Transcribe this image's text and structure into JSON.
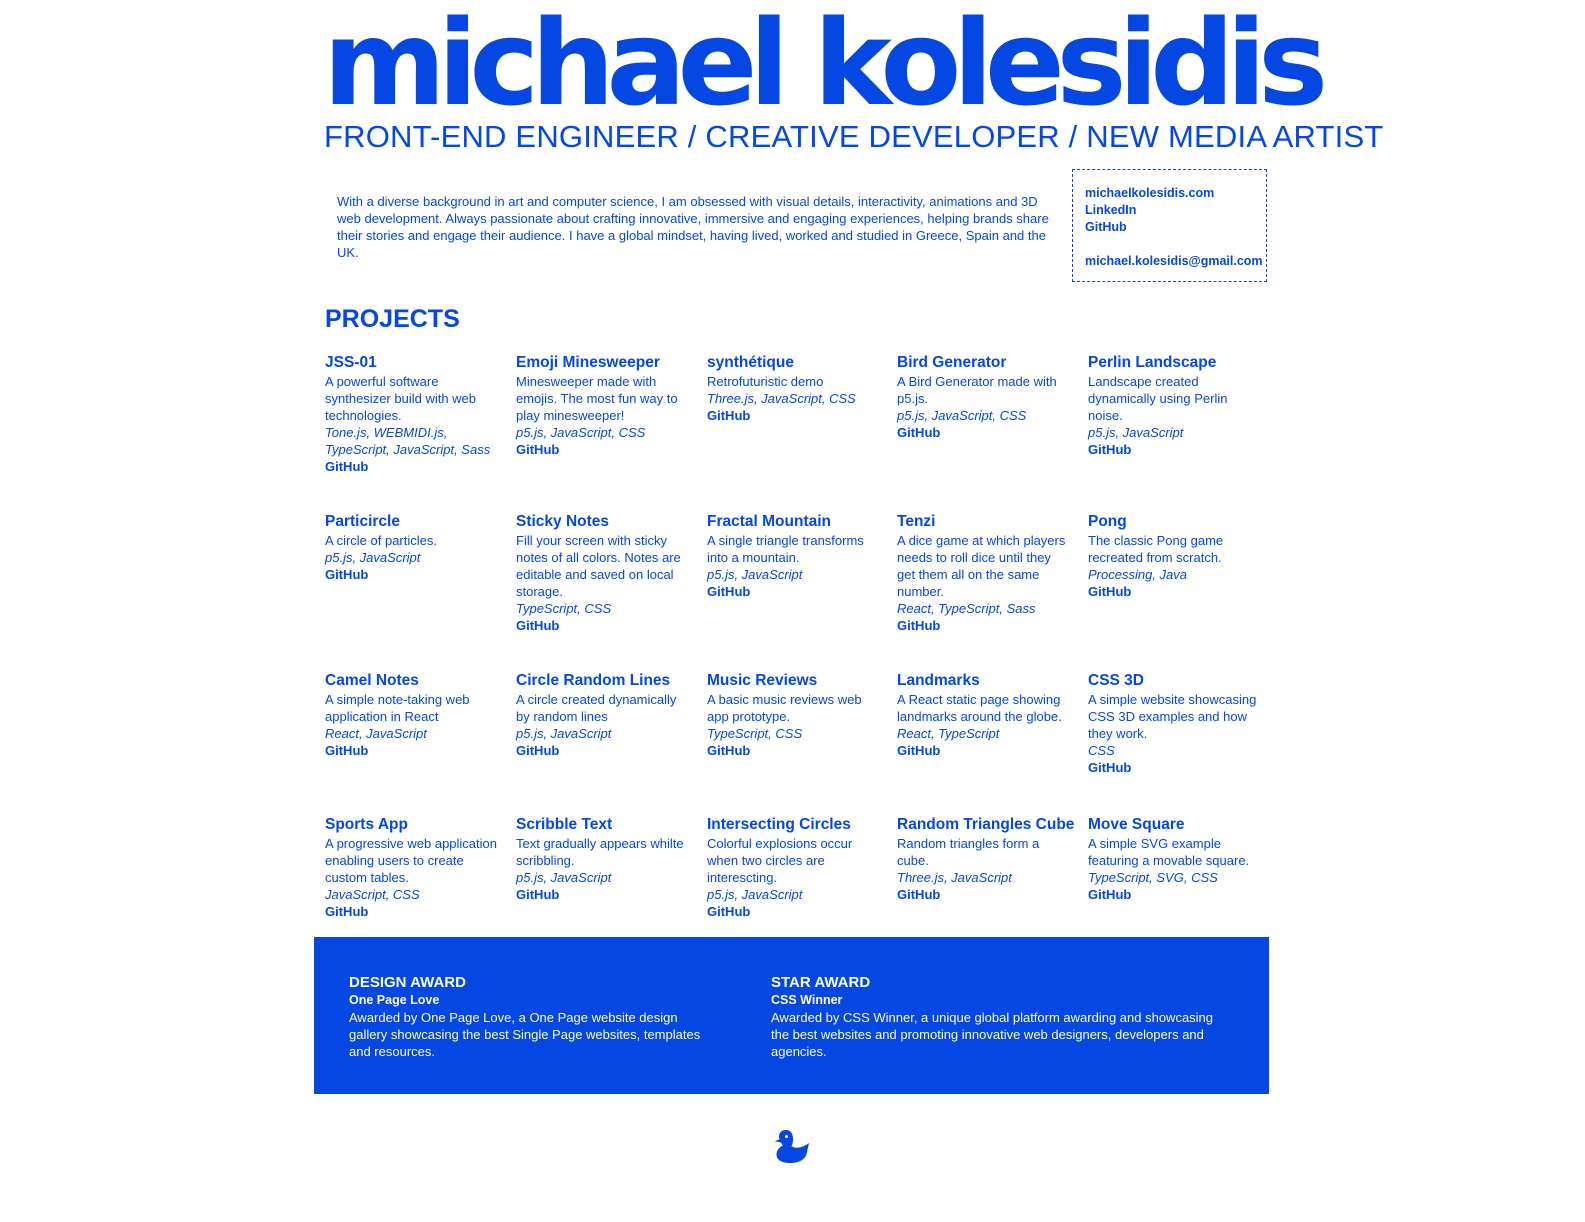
{
  "header": {
    "name": "michael kolesidis",
    "subtitle": "FRONT-END ENGINEER / CREATIVE DEVELOPER / NEW MEDIA ARTIST"
  },
  "bio": "With a diverse background in art and computer science, I am obsessed with visual details, interactivity, animations and 3D web development. Always passionate about crafting innovative, immersive and engaging experiences, helping brands share their stories and engage their audience. I have a global mindset, having lived, worked and studied in Greece, Spain and the UK.",
  "contact": {
    "website": "michaelkolesidis.com",
    "linkedin": "LinkedIn",
    "github": "GitHub",
    "email": "michael.kolesidis@gmail.com"
  },
  "projects_heading": "PROJECTS",
  "projects": [
    {
      "title": "JSS-01",
      "desc": "A powerful software synthesizer build with web technologies.",
      "tech": "Tone.js, WEBMIDI.js, TypeScript, JavaScript, Sass",
      "link": "GitHub"
    },
    {
      "title": "Emoji Minesweeper",
      "desc": "Minesweeper made with emojis. The most fun way to play minesweeper!",
      "tech": "p5.js, JavaScript, CSS",
      "link": "GitHub"
    },
    {
      "title": "synthétique",
      "desc": "Retrofuturistic demo",
      "tech": "Three.js, JavaScript, CSS",
      "link": "GitHub"
    },
    {
      "title": "Bird Generator",
      "desc": "A Bird Generator made with p5.js.",
      "tech": "p5.js, JavaScript, CSS",
      "link": "GitHub"
    },
    {
      "title": "Perlin Landscape",
      "desc": "Landscape created dynamically using Perlin noise.",
      "tech": "p5.js, JavaScript",
      "link": "GitHub"
    },
    {
      "title": "Particircle",
      "desc": "A circle of particles.",
      "tech": "p5.js, JavaScript",
      "link": "GitHub"
    },
    {
      "title": "Sticky Notes",
      "desc": "Fill your screen with sticky notes of all colors. Notes are editable and saved on local storage.",
      "tech": "TypeScript, CSS",
      "link": "GitHub"
    },
    {
      "title": "Fractal Mountain",
      "desc": "A single triangle transforms into a mountain.",
      "tech": "p5.js, JavaScript",
      "link": "GitHub"
    },
    {
      "title": "Tenzi",
      "desc": "A dice game at which players needs to roll dice until they get them all on the same number.",
      "tech": "React, TypeScript, Sass",
      "link": "GitHub"
    },
    {
      "title": "Pong",
      "desc": "The classic Pong game recreated from scratch.",
      "tech": "Processing, Java",
      "link": "GitHub"
    },
    {
      "title": "Camel Notes",
      "desc": "A simple note-taking web application in React",
      "tech": "React, JavaScript",
      "link": "GitHub"
    },
    {
      "title": "Circle Random Lines",
      "desc": "A circle created dynamically by random lines",
      "tech": "p5.js, JavaScript",
      "link": "GitHub"
    },
    {
      "title": "Music Reviews",
      "desc": "A basic music reviews web app prototype.",
      "tech": "TypeScript, CSS",
      "link": "GitHub"
    },
    {
      "title": "Landmarks",
      "desc": "A React static page showing landmarks around the globe.",
      "tech": "React, TypeScript",
      "link": "GitHub"
    },
    {
      "title": "CSS 3D",
      "desc": "A simple website showcasing CSS 3D examples and how they work.",
      "tech": "CSS",
      "link": "GitHub"
    },
    {
      "title": "Sports App",
      "desc": "A progressive web application enabling users to create custom tables.",
      "tech": "JavaScript, CSS",
      "link": "GitHub"
    },
    {
      "title": "Scribble Text",
      "desc": "Text gradually appears whilte scribbling.",
      "tech": "p5.js, JavaScript",
      "link": "GitHub"
    },
    {
      "title": "Intersecting Circles",
      "desc": "Colorful explosions occur when two circles are interescting.",
      "tech": "p5.js, JavaScript",
      "link": "GitHub"
    },
    {
      "title": "Random Triangles Cube",
      "desc": "Random triangles form a cube.",
      "tech": "Three.js, JavaScript",
      "link": "GitHub"
    },
    {
      "title": "Move Square",
      "desc": "A simple SVG example featuring a movable square.",
      "tech": "TypeScript, SVG, CSS",
      "link": "GitHub"
    }
  ],
  "awards": [
    {
      "title": "DESIGN AWARD",
      "subtitle": "One Page Love",
      "desc": "Awarded by One Page Love, a One Page website design gallery showcasing the best Single Page websites, templates and resources."
    },
    {
      "title": "STAR AWARD",
      "subtitle": "CSS Winner",
      "desc": "Awarded by CSS Winner, a unique global platform awarding and showcasing the best websites and promoting innovative web designers, developers and agencies."
    }
  ],
  "footer": {
    "icon": "duck-icon"
  },
  "colors": {
    "accent": "#0547e2",
    "background": "#ffffff",
    "awards_text": "#ffffff"
  }
}
